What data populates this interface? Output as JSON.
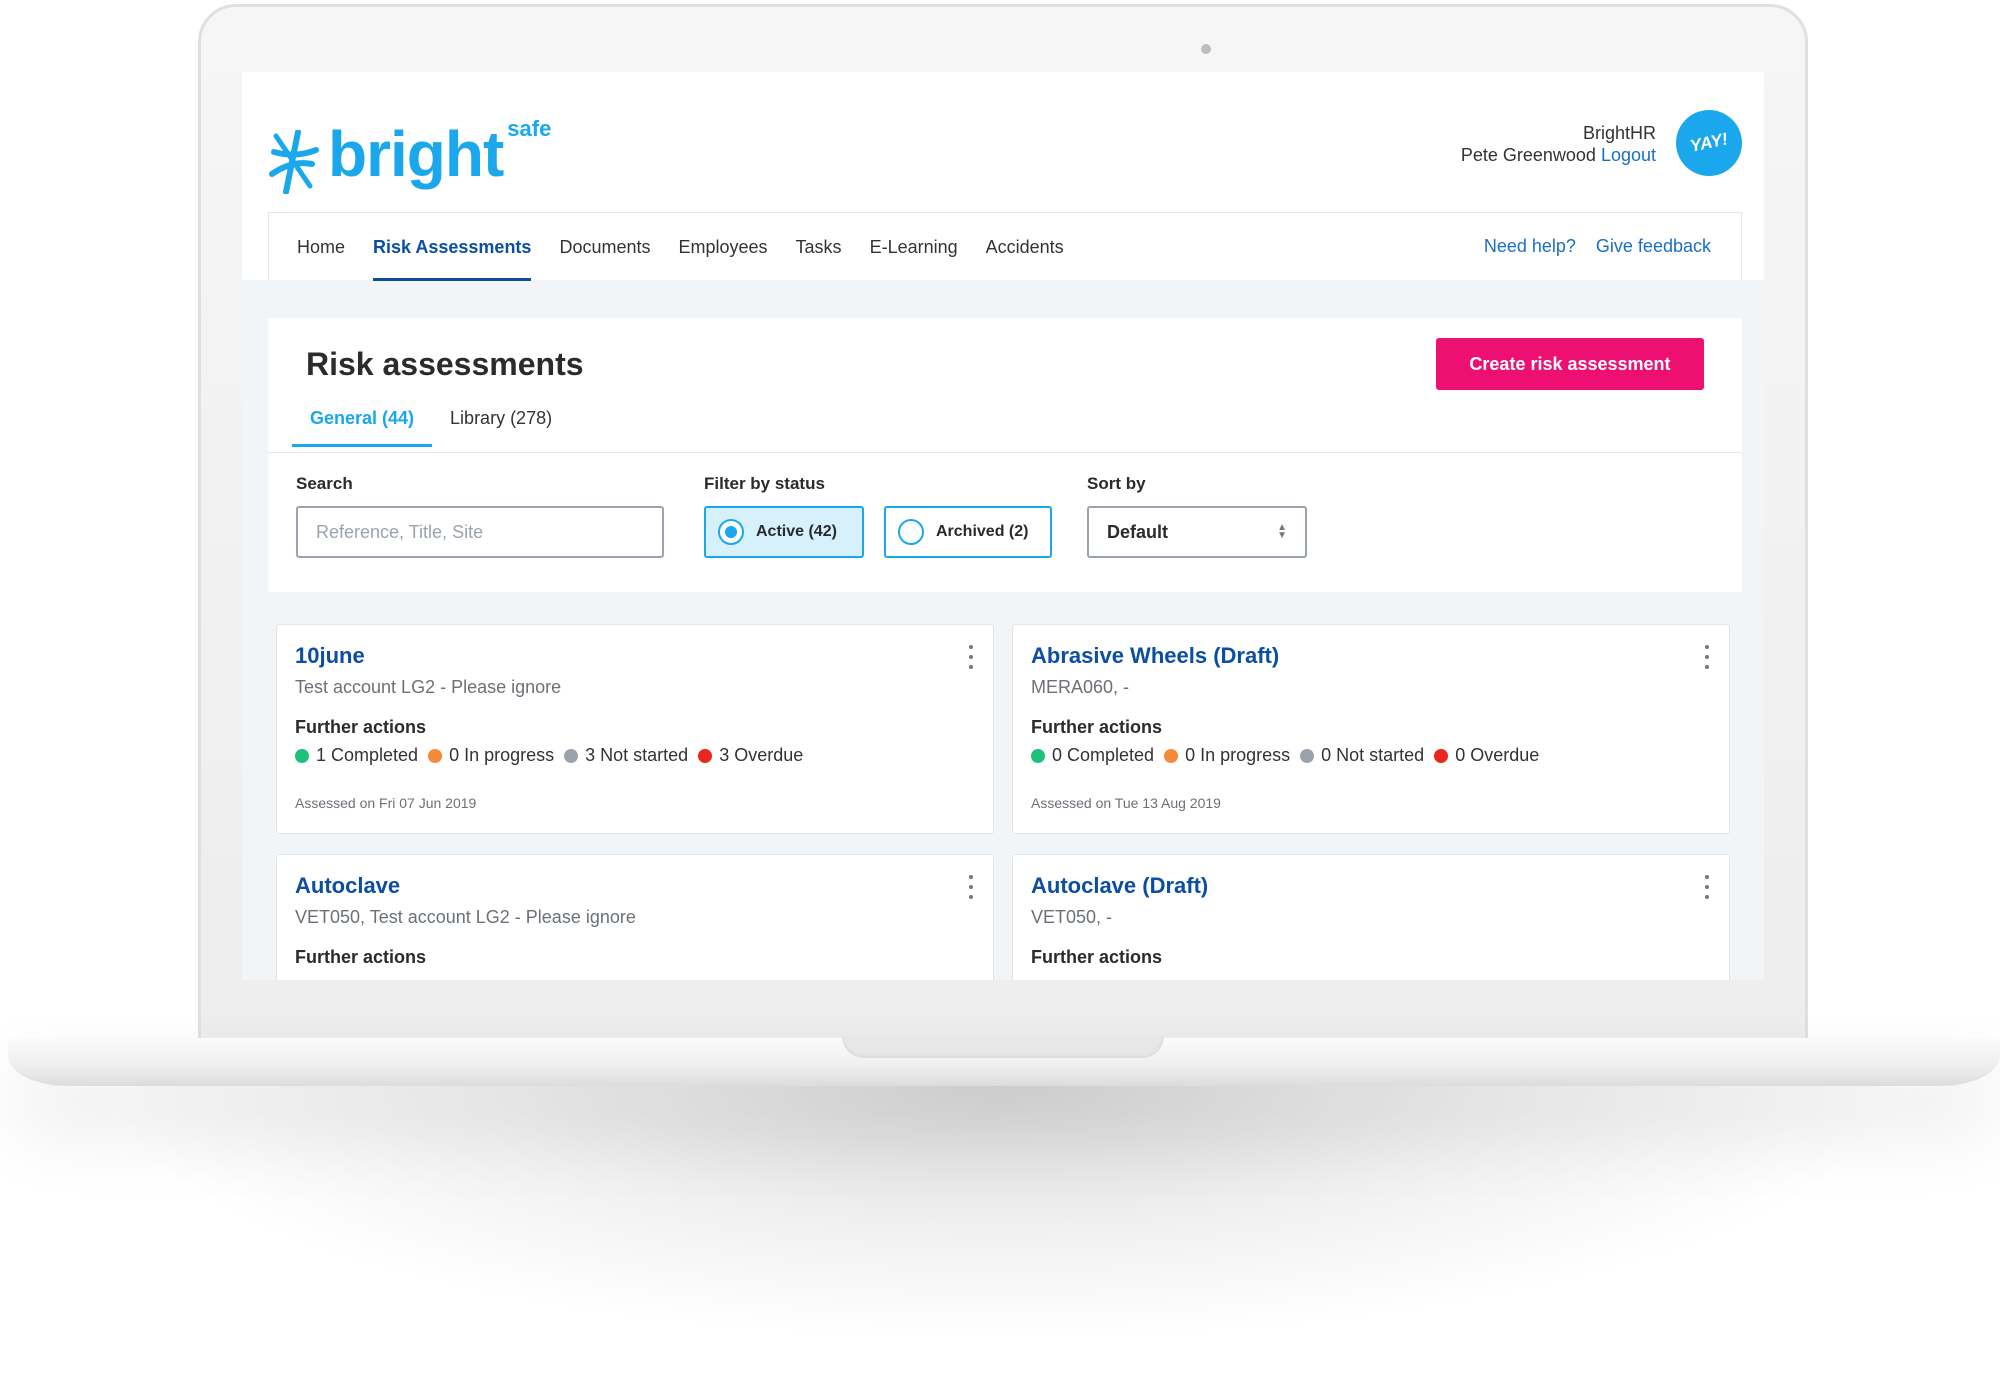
{
  "app": {
    "logo_text": "bright",
    "logo_sup": "safe",
    "company": "BrightHR",
    "user_name": "Pete Greenwood",
    "logout_label": "Logout",
    "avatar_text": "YAY!"
  },
  "nav": {
    "items": [
      {
        "label": "Home"
      },
      {
        "label": "Risk Assessments"
      },
      {
        "label": "Documents"
      },
      {
        "label": "Employees"
      },
      {
        "label": "Tasks"
      },
      {
        "label": "E-Learning"
      },
      {
        "label": "Accidents"
      }
    ],
    "active_index": 1,
    "help_label": "Need help?",
    "feedback_label": "Give feedback"
  },
  "page": {
    "title": "Risk assessments",
    "create_button": "Create risk assessment",
    "tabs": [
      {
        "label": "General (44)"
      },
      {
        "label": "Library (278)"
      }
    ]
  },
  "filters": {
    "search_label": "Search",
    "search_placeholder": "Reference, Title, Site",
    "status_label": "Filter by status",
    "status_active": "Active (42)",
    "status_archived": "Archived (2)",
    "sort_label": "Sort by",
    "sort_value": "Default"
  },
  "colors": {
    "completed": "#1ec07a",
    "in_progress": "#f5893a",
    "not_started": "#9aa3ad",
    "overdue": "#e8281e",
    "brand": "#1aa7ec",
    "accent": "#ee0f72",
    "link": "#0b4ea2"
  },
  "cards": [
    {
      "title": "10june",
      "subtitle": "Test account LG2 - Please ignore",
      "further_label": "Further actions",
      "completed": "1 Completed",
      "in_progress": "0 In progress",
      "not_started": "3 Not started",
      "overdue": "3 Overdue",
      "assessed": "Assessed on Fri 07 Jun 2019"
    },
    {
      "title": "Abrasive Wheels (Draft)",
      "subtitle": "MERA060, -",
      "further_label": "Further actions",
      "completed": "0 Completed",
      "in_progress": "0 In progress",
      "not_started": "0 Not started",
      "overdue": "0 Overdue",
      "assessed": "Assessed on Tue 13 Aug 2019"
    },
    {
      "title": "Autoclave",
      "subtitle": "VET050, Test account LG2 - Please ignore",
      "further_label": "Further actions"
    },
    {
      "title": "Autoclave (Draft)",
      "subtitle": "VET050, -",
      "further_label": "Further actions"
    }
  ]
}
